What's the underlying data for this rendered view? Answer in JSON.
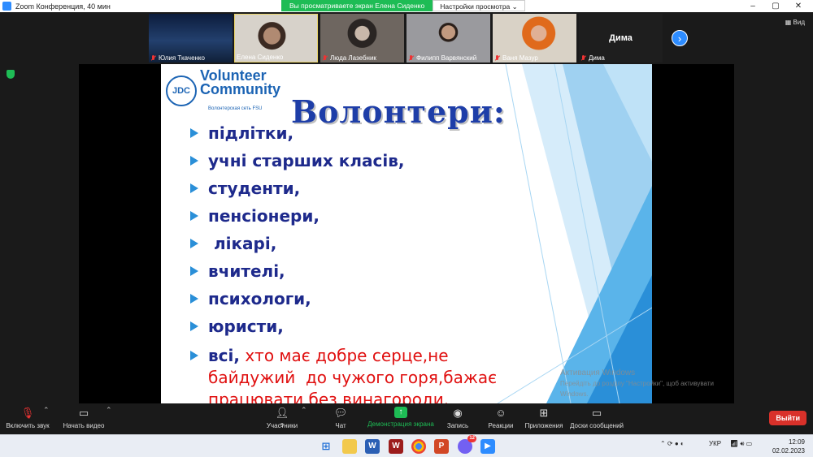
{
  "window": {
    "title": "Zoom Конференция, 40 мин"
  },
  "banner": {
    "sharing_text": "Вы просматриваете экран Елена Сиденко",
    "view_options": "Настройки просмотра ⌄"
  },
  "gallery": {
    "participants": [
      "Юлия Ткаченко",
      "Елена Сиденко",
      "Люда Лазебник",
      "Филипп Варвянский",
      "Ваня Мазур",
      "Дима"
    ],
    "big_name": "Дима",
    "view_label": "Вид"
  },
  "slide": {
    "logo_line1": "Volunteer",
    "logo_line2": "Community",
    "logo_jdc": "JDC",
    "logo_sub": "Волонтерская сеть FSU",
    "heading": "Волонтери:",
    "items": [
      "підлітки,",
      "учні старших класів,",
      "студенти,",
      "пенсіонери,",
      " лікарі,",
      "вчителі,",
      "психологи,",
      "юристи,"
    ],
    "last_item_blue": "всі,",
    "last_item_red_line1": " хто має добре серце,не",
    "last_item_red_line2": "байдужий  до чужого горя,бажає",
    "last_item_red_line3": "працювати без винагороди.",
    "watermark_line1": "Активация Windows",
    "watermark_line2": "Перейдіть до розділу \"Настройки\", щоб активувати",
    "watermark_line3": "Windows."
  },
  "toolbar": {
    "audio": "Включить звук",
    "video": "Начать видео",
    "participants": "Участники",
    "participants_count": "9",
    "chat": "Чат",
    "share": "Демонстрация экрана",
    "record": "Запись",
    "reactions": "Реакции",
    "apps": "Приложения",
    "whiteboard": "Доски сообщений",
    "leave": "Выйти"
  },
  "taskbar": {
    "language": "УКР",
    "time": "12:09",
    "date": "02.02.2023",
    "viber_badge": "12"
  },
  "colors": {
    "zoom_blue": "#2d8cff",
    "share_green": "#1ebc55",
    "leave_red": "#d9312a",
    "slide_blue_text": "#1e2a8c",
    "slide_red_text": "#e01010"
  }
}
